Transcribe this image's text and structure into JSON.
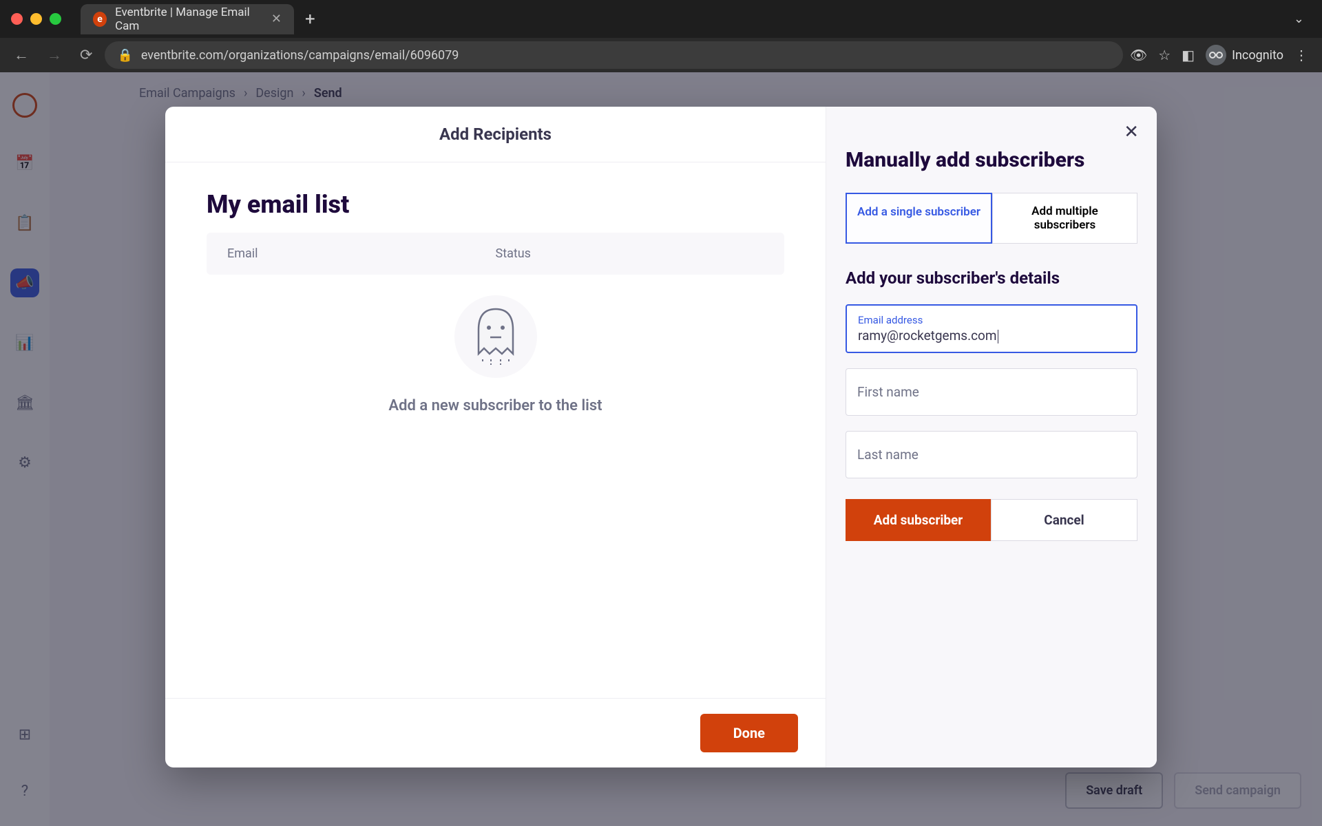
{
  "browser": {
    "tab_title": "Eventbrite | Manage Email Cam",
    "url": "eventbrite.com/organizations/campaigns/email/6096079",
    "incognito": "Incognito"
  },
  "breadcrumbs": {
    "item1": "Email Campaigns",
    "item2": "Design",
    "item3": "Send"
  },
  "footer": {
    "save_draft": "Save draft",
    "send_campaign": "Send campaign"
  },
  "modal": {
    "header": "Add Recipients",
    "list_title": "My email list",
    "th_email": "Email",
    "th_status": "Status",
    "empty_text": "Add a new subscriber to the list",
    "done_label": "Done"
  },
  "panel": {
    "title": "Manually add subscribers",
    "tab_single": "Add a single subscriber",
    "tab_multiple": "Add multiple subscribers",
    "section_title": "Add your subscriber's details",
    "email_label": "Email address",
    "email_value": "ramy@rocketgems.com",
    "first_name_placeholder": "First name",
    "last_name_placeholder": "Last name",
    "add_btn": "Add subscriber",
    "cancel_btn": "Cancel"
  }
}
